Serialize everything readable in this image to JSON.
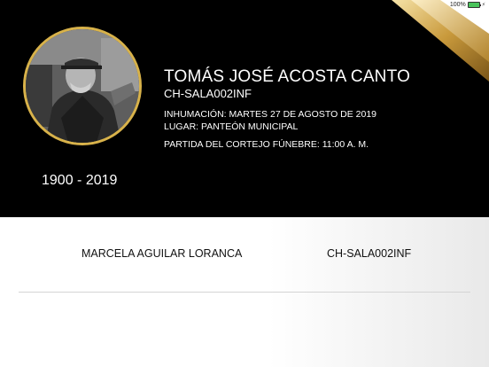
{
  "status": {
    "battery_text": "100%"
  },
  "deceased": {
    "name": "TOMÁS JOSÉ ACOSTA CANTO",
    "code": "CH-SALA002INF",
    "burial": "INHUMACIÓN: MARTES 27 DE AGOSTO DE 2019",
    "place": "LUGAR: PANTEÓN MUNICIPAL",
    "procession": "PARTIDA DEL CORTEJO FÚNEBRE: 11:00 A. M.",
    "years": "1900 - 2019"
  },
  "list": {
    "rows": [
      {
        "name": "MARCELA AGUILAR LORANCA",
        "code": "CH-SALA002INF"
      }
    ]
  },
  "colors": {
    "accent_gold": "#d8b24a",
    "header_bg": "#000000",
    "battery_green": "#49c35b"
  }
}
